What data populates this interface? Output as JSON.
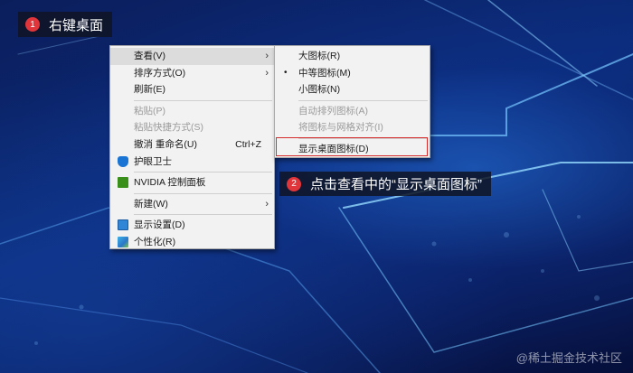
{
  "steps": [
    {
      "number": "1",
      "text": "右键桌面"
    },
    {
      "number": "2",
      "text": "点击查看中的“显示桌面图标”"
    }
  ],
  "context_menu": {
    "items": [
      {
        "label": "查看(V)",
        "submenu": true
      },
      {
        "label": "排序方式(O)",
        "submenu": true
      },
      {
        "label": "刷新(E)"
      },
      {
        "label": "粘贴(P)",
        "disabled": true
      },
      {
        "label": "粘贴快捷方式(S)",
        "disabled": true
      },
      {
        "label": "撤消 重命名(U)",
        "shortcut": "Ctrl+Z"
      },
      {
        "label": "护眼卫士",
        "icon": "shield-icon"
      },
      {
        "label": "NVIDIA 控制面板",
        "icon": "nvidia-icon"
      },
      {
        "label": "新建(W)",
        "submenu": true
      },
      {
        "label": "显示设置(D)",
        "icon": "display-settings-icon"
      },
      {
        "label": "个性化(R)",
        "icon": "personalize-icon"
      }
    ]
  },
  "view_submenu": {
    "items": [
      {
        "label": "大图标(R)"
      },
      {
        "label": "中等图标(M)",
        "checked": true
      },
      {
        "label": "小图标(N)"
      },
      {
        "label": "自动排列图标(A)",
        "disabled": true
      },
      {
        "label": "将图标与网格对齐(I)",
        "disabled": true
      },
      {
        "label": "显示桌面图标(D)",
        "highlighted": true
      }
    ],
    "checked_mark": "•"
  },
  "watermark": "@稀土掘金技术社区",
  "colors": {
    "badge": "#e0353a",
    "highlight_border": "#d62b2b",
    "menu_bg": "#f2f2f2"
  }
}
